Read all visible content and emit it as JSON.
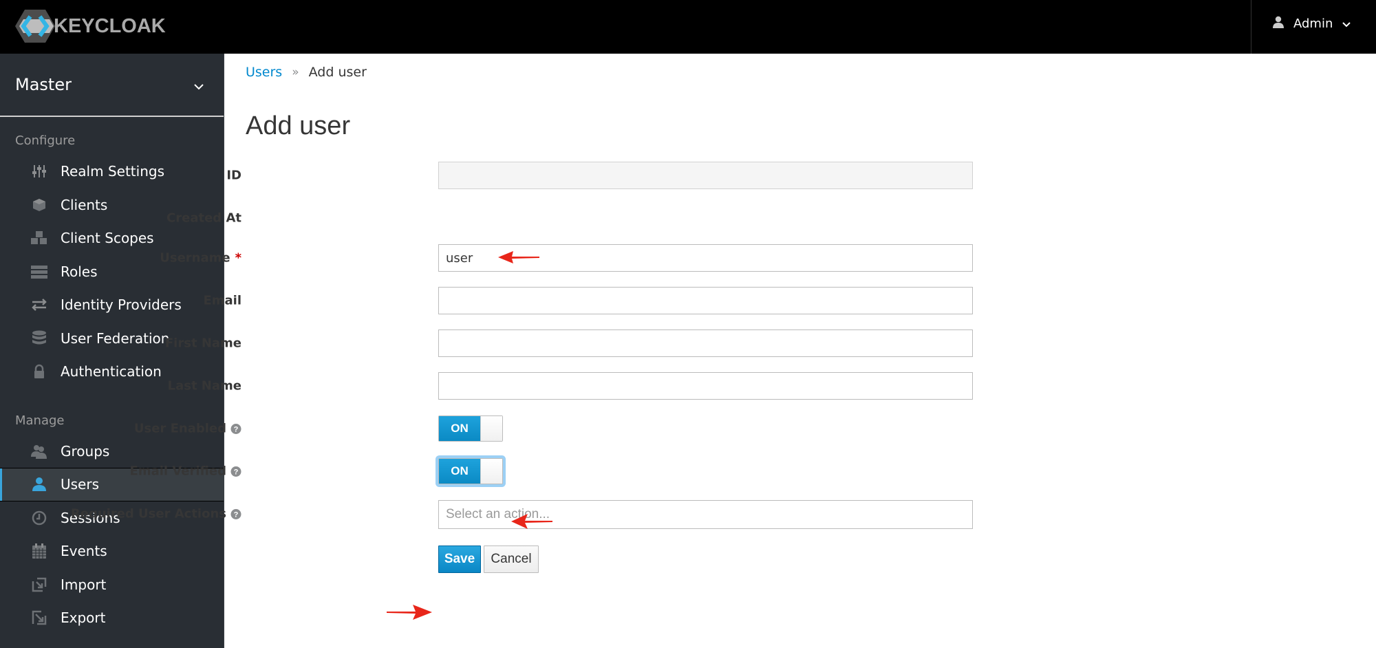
{
  "topbar": {
    "logo_text": "KEYCLOAK",
    "user_menu_label": "Admin",
    "user_icon": "user-icon",
    "chevron_icon": "chevron-down-icon"
  },
  "sidebar": {
    "realm": "Master",
    "sections": [
      {
        "title": "Configure",
        "items": [
          {
            "label": "Realm Settings",
            "icon": "sliders-icon"
          },
          {
            "label": "Clients",
            "icon": "cube-icon"
          },
          {
            "label": "Client Scopes",
            "icon": "cubes-icon"
          },
          {
            "label": "Roles",
            "icon": "list-icon"
          },
          {
            "label": "Identity Providers",
            "icon": "exchange-icon"
          },
          {
            "label": "User Federation",
            "icon": "database-icon"
          },
          {
            "label": "Authentication",
            "icon": "lock-icon"
          }
        ]
      },
      {
        "title": "Manage",
        "items": [
          {
            "label": "Groups",
            "icon": "users-icon"
          },
          {
            "label": "Users",
            "icon": "user-icon",
            "active": true
          },
          {
            "label": "Sessions",
            "icon": "clock-icon"
          },
          {
            "label": "Events",
            "icon": "calendar-icon"
          },
          {
            "label": "Import",
            "icon": "import-icon"
          },
          {
            "label": "Export",
            "icon": "export-icon"
          }
        ]
      }
    ]
  },
  "main": {
    "breadcrumb": {
      "link": "Users",
      "separator": "»",
      "current": "Add user"
    },
    "title": "Add user",
    "fields": {
      "id": {
        "label": "ID",
        "value": ""
      },
      "created_at": {
        "label": "Created At",
        "value": ""
      },
      "username": {
        "label": "Username",
        "required_mark": "*",
        "value": "user"
      },
      "email": {
        "label": "Email",
        "value": ""
      },
      "first_name": {
        "label": "First Name",
        "value": ""
      },
      "last_name": {
        "label": "Last Name",
        "value": ""
      },
      "user_enabled": {
        "label": "User Enabled",
        "state": "ON"
      },
      "email_verified": {
        "label": "Email Verified",
        "state": "ON"
      },
      "required_actions": {
        "label": "Required User Actions",
        "placeholder": "Select an action..."
      }
    },
    "buttons": {
      "save": "Save",
      "cancel": "Cancel"
    }
  },
  "colors": {
    "accent": "#0088ce",
    "toggle_on": "#1a9ad6",
    "sidebar_bg": "#292e34",
    "annotation_arrow": "#e8261a"
  }
}
